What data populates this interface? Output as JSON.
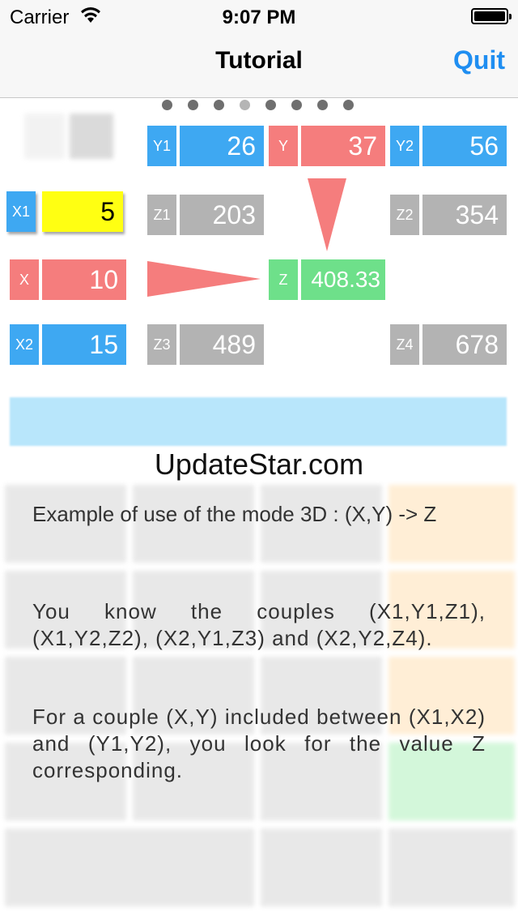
{
  "status_bar": {
    "carrier": "Carrier",
    "time": "9:07 PM"
  },
  "nav": {
    "title": "Tutorial",
    "quit_label": "Quit"
  },
  "pager": {
    "count": 8,
    "active_index": 3
  },
  "grid": {
    "y1": {
      "tag": "Y1",
      "value": "26"
    },
    "y": {
      "tag": "Y",
      "value": "37"
    },
    "y2": {
      "tag": "Y2",
      "value": "56"
    },
    "x1": {
      "tag": "X1",
      "value": "5"
    },
    "z1": {
      "tag": "Z1",
      "value": "203"
    },
    "z2": {
      "tag": "Z2",
      "value": "354"
    },
    "x": {
      "tag": "X",
      "value": "10"
    },
    "z": {
      "tag": "Z",
      "value": "408.33"
    },
    "x2": {
      "tag": "X2",
      "value": "15"
    },
    "z3": {
      "tag": "Z3",
      "value": "489"
    },
    "z4": {
      "tag": "Z4",
      "value": "678"
    }
  },
  "watermark": "UpdateStar.com",
  "tutorial": {
    "p1": "Example of use of the mode 3D : (X,Y) -> Z",
    "p2": "You know the couples (X1,Y1,Z1), (X1,Y2,Z2), (X2,Y1,Z3) and (X2,Y2,Z4).",
    "p3": "For a couple (X,Y) included between (X1,X2) and (Y1,Y2), you look for the value Z corresponding."
  },
  "colors": {
    "blue": "#3ea8f2",
    "red": "#f57d7d",
    "gray": "#b3b3b3",
    "green": "#6ee08a",
    "yellow": "#ffff12",
    "accent": "#1f8ef1"
  }
}
